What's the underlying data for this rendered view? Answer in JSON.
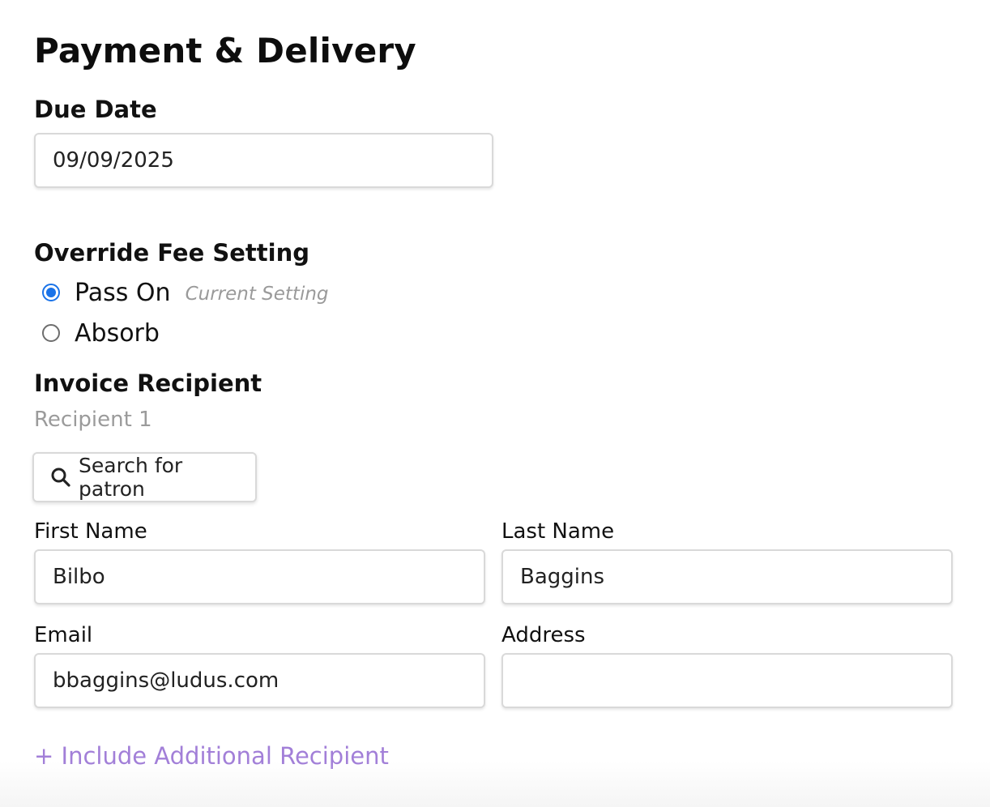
{
  "page": {
    "title": "Payment & Delivery"
  },
  "due_date": {
    "label": "Due Date",
    "value": "09/09/2025"
  },
  "fee_setting": {
    "label": "Override Fee Setting",
    "options": [
      {
        "label": "Pass On",
        "hint": "Current Setting",
        "selected": true
      },
      {
        "label": "Absorb",
        "hint": "",
        "selected": false
      }
    ]
  },
  "recipient": {
    "label": "Invoice Recipient",
    "subtitle": "Recipient 1",
    "search_button": {
      "label": "Search for patron",
      "icon": "search-icon"
    },
    "first_name": {
      "label": "First Name",
      "value": "Bilbo"
    },
    "last_name": {
      "label": "Last Name",
      "value": "Baggins"
    },
    "email": {
      "label": "Email",
      "value": "bbaggins@ludus.com"
    },
    "address": {
      "label": "Address",
      "value": ""
    },
    "add_link": "+ Include Additional Recipient"
  },
  "colors": {
    "accent_radio": "#1a73e8",
    "link": "#a27fd8",
    "muted_text": "#9b9b9b",
    "border": "#d9d9d9"
  }
}
